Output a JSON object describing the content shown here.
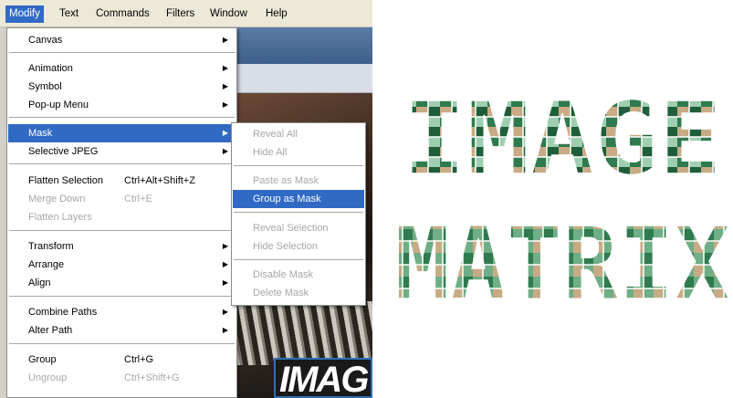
{
  "menubar": {
    "items": [
      {
        "label": "Modify",
        "active": true
      },
      {
        "label": "Text"
      },
      {
        "label": "Commands"
      },
      {
        "label": "Filters"
      },
      {
        "label": "Window"
      },
      {
        "label": "Help"
      }
    ]
  },
  "modify_menu": {
    "items": [
      {
        "label": "Canvas",
        "submenu": true
      },
      {
        "label": "Animation",
        "submenu": true
      },
      {
        "label": "Symbol",
        "submenu": true
      },
      {
        "label": "Pop-up Menu",
        "submenu": true
      },
      {
        "label": "Mask",
        "submenu": true,
        "highlighted": true
      },
      {
        "label": "Selective JPEG",
        "submenu": true
      },
      {
        "label": "Flatten Selection",
        "shortcut": "Ctrl+Alt+Shift+Z"
      },
      {
        "label": "Merge Down",
        "shortcut": "Ctrl+E",
        "disabled": true
      },
      {
        "label": "Flatten Layers",
        "disabled": true
      },
      {
        "label": "Transform",
        "submenu": true
      },
      {
        "label": "Arrange",
        "submenu": true
      },
      {
        "label": "Align",
        "submenu": true
      },
      {
        "label": "Combine Paths",
        "submenu": true
      },
      {
        "label": "Alter Path",
        "submenu": true
      },
      {
        "label": "Group",
        "shortcut": "Ctrl+G"
      },
      {
        "label": "Ungroup",
        "shortcut": "Ctrl+Shift+G",
        "disabled": true
      }
    ]
  },
  "mask_submenu": {
    "items": [
      {
        "label": "Reveal All",
        "disabled": true
      },
      {
        "label": "Hide All",
        "disabled": true
      },
      {
        "label": "Paste as Mask",
        "disabled": true
      },
      {
        "label": "Group as Mask",
        "highlighted": true
      },
      {
        "label": "Reveal Selection",
        "disabled": true
      },
      {
        "label": "Hide Selection",
        "disabled": true
      },
      {
        "label": "Disable Mask",
        "disabled": true
      },
      {
        "label": "Delete Mask",
        "disabled": true
      }
    ]
  },
  "canvas_photo_text": "IMAG",
  "logo": {
    "line1": "IMAGE",
    "line2": "MATRIX"
  },
  "colors": {
    "highlight": "#316ac5",
    "disabled_text": "#a7a6aa",
    "logo_green": "#2f7a4e",
    "logo_tan": "#c8ab84",
    "logo_red": "#b3261e"
  }
}
